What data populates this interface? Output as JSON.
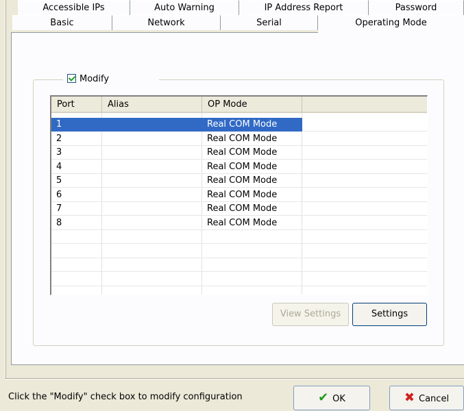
{
  "tabs": {
    "row1": [
      "Accessible IPs",
      "Auto Warning",
      "IP Address Report",
      "Password"
    ],
    "row2": [
      "Basic",
      "Network",
      "Serial",
      "Operating Mode"
    ],
    "active": "Operating Mode"
  },
  "group": {
    "modify_label": "Modify",
    "modify_checked": true
  },
  "list": {
    "columns": [
      "Port",
      "Alias",
      "OP Mode",
      ""
    ],
    "rows": [
      {
        "port": "1",
        "alias": "",
        "op_mode": "Real COM Mode"
      },
      {
        "port": "2",
        "alias": "",
        "op_mode": "Real COM Mode"
      },
      {
        "port": "3",
        "alias": "",
        "op_mode": "Real COM Mode"
      },
      {
        "port": "4",
        "alias": "",
        "op_mode": "Real COM Mode"
      },
      {
        "port": "5",
        "alias": "",
        "op_mode": "Real COM Mode"
      },
      {
        "port": "6",
        "alias": "",
        "op_mode": "Real COM Mode"
      },
      {
        "port": "7",
        "alias": "",
        "op_mode": "Real COM Mode"
      },
      {
        "port": "8",
        "alias": "",
        "op_mode": "Real COM Mode"
      }
    ]
  },
  "buttons": {
    "view_settings": "View Settings",
    "settings": "Settings",
    "ok": "OK",
    "cancel": "Cancel"
  },
  "icons": {
    "ok": "checkmark-icon",
    "cancel": "x-mark-icon"
  },
  "status_text": "Click the \"Modify\" check box to modify configuration"
}
